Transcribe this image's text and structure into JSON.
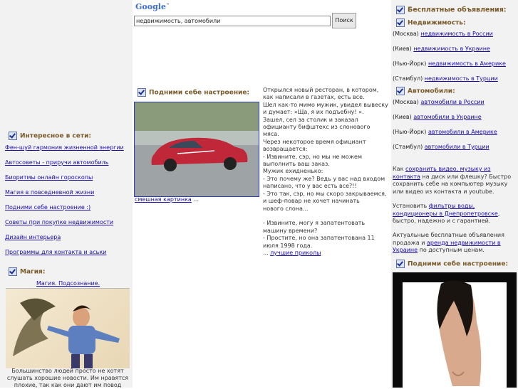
{
  "google": {
    "logo_text": "Google",
    "logo_tm": "™",
    "search_value": "недвижимость, автомобили",
    "search_button": "Поиск"
  },
  "left": {
    "section1_title": "Интересное в сети:",
    "links": [
      "Фен-шуй гармония жизненной энергии",
      "Автосоветы - приручи автомобиль",
      "Биоритмы онлайн гороскопы",
      "Магия в повседневной жизни",
      "Подними себе настроение :)",
      "Советы при покупке недвижимости",
      "Дизайн интерьера",
      "Программы для контакта и аськи"
    ],
    "section2_title": "Магия:",
    "magic_link": "Магия. Подсознание.",
    "magic_text_1": "Большинство людей просто не хотят",
    "magic_text_2": "слушать хорошие новости. Им нравятся",
    "magic_text_3": "плохие, так как они дают им повод"
  },
  "mid": {
    "section_title": "Подними себе настроение:",
    "caption_link": "смешная картинка",
    "caption_suffix": " ...",
    "story_lines": [
      "Открылся новый ресторан, в котором,",
      "как написали в газетах, есть все.",
      "Шел как-то мимо мужик, увидел вывеску",
      "и думает: «Ща, я их подъебну! ».",
      "Зашел, сел за столик и заказал",
      "официанту бифштекс из слонового",
      "мяса.",
      "Через некоторое время официант",
      "возвращается:",
      "- Извините, сэр, но мы не можем",
      "выполнить ваш заказ.",
      "Мужик ехидненько:",
      "- Это почему же? Ведь у вас над входом",
      "написано, что у вас есть все?!!",
      "- Это так, сэр, но мы скоро закрываемся,",
      "и шеф-повар не хочет начинать",
      "нового слона...",
      "",
      "- Извините, могу я запатентовать",
      "машину времени?",
      "- Простите, но она запатентована 11",
      "июля 1998 года."
    ],
    "story_more_prefix": "... ",
    "story_more_link": "лучшие приколы"
  },
  "right": {
    "title": "Бесплатные объявления:",
    "realty_title": "Недвижимость:",
    "realty": [
      {
        "city": "(Москва) ",
        "link": "недвижимость в России"
      },
      {
        "city": "(Киев) ",
        "link": "недвижимость в Украине"
      },
      {
        "city": "(Нью-Йорк) ",
        "link": "недвижимость в Америке"
      },
      {
        "city": "(Стамбул) ",
        "link": "недвижимость в Турции"
      }
    ],
    "auto_title": "Автомобили:",
    "auto": [
      {
        "city": "(Москва) ",
        "link": "автомобили в России"
      },
      {
        "city": "(Киев) ",
        "link": "автомобили в Украине"
      },
      {
        "city": "(Нью-Йорк) ",
        "link": "автомобили в Америке"
      },
      {
        "city": "(Стамбул) ",
        "link": "автомобили в Турции"
      }
    ],
    "p1_pre": "Как ",
    "p1_link": "сохранить видео, музыку из контакта",
    "p1_post": " на диск или флешку? Быстро сохранить себе на компьютер музыку или видео из контакта и youtube.",
    "p2_pre": "Установить ",
    "p2_link": "фильтры воды, кондиционеры в Днепропетровске",
    "p2_post": ", быстро, надежно и с гарантией.",
    "p3_pre": "Актуальные бесплатные объявления продажа и ",
    "p3_link": "аренда недвижимости в Украине",
    "p3_post": " по доступным ценам.",
    "mood_title": "Подними себе настроение:"
  }
}
